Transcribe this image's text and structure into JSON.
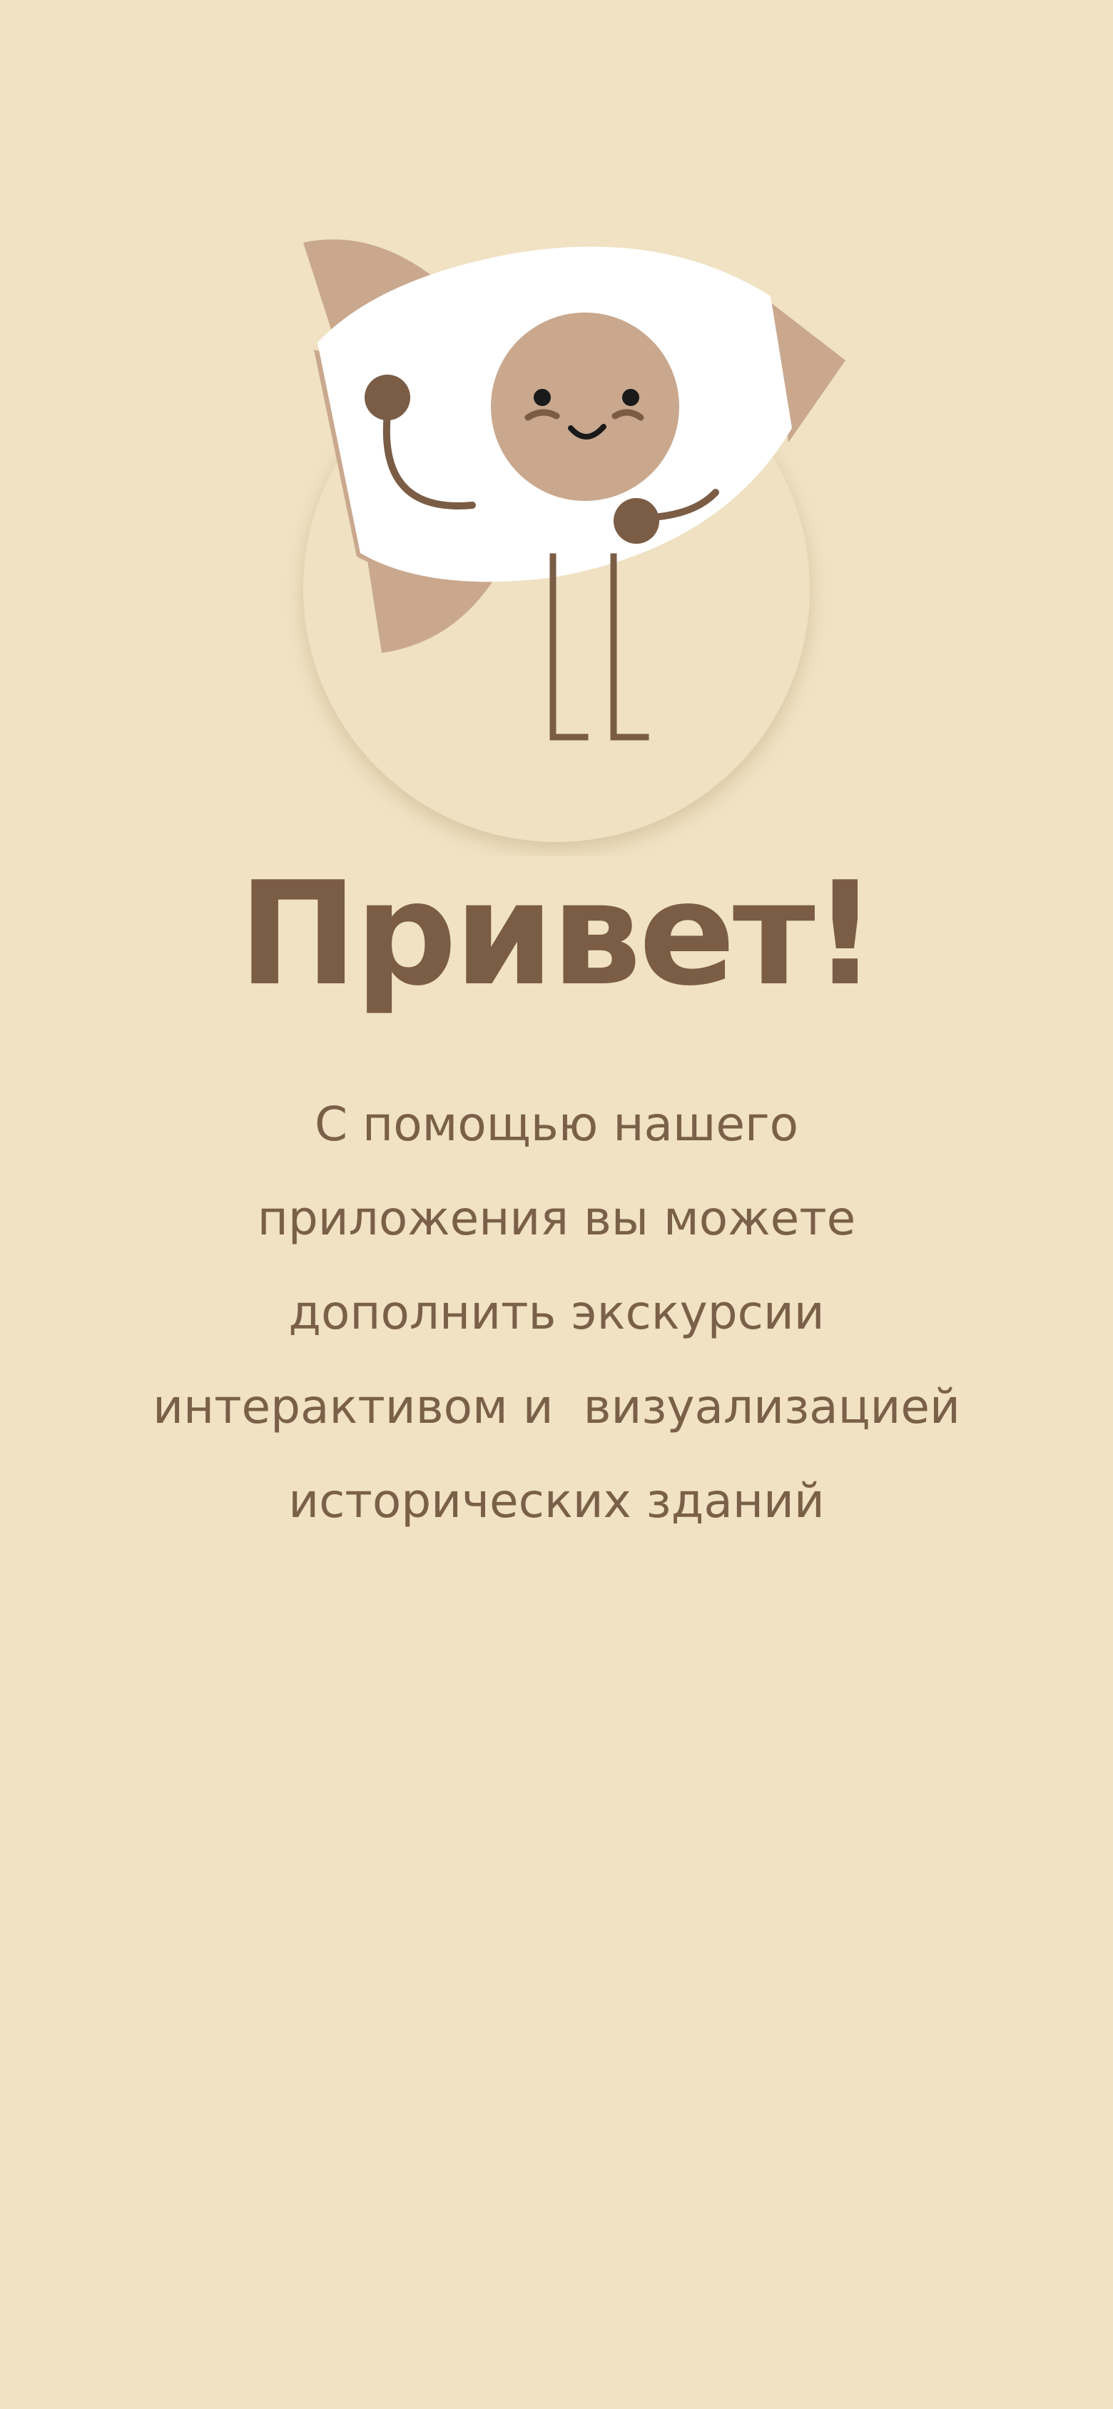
{
  "greeting": {
    "title": "Привет!",
    "lines": [
      "С помощью нашего",
      "приложения вы можете",
      "дополнить экскурсии",
      "интерактивом и  визуализацией",
      "исторических зданий"
    ]
  },
  "colors": {
    "background": "#f0e2c3",
    "accent_dark": "#7b5c45",
    "accent_tan": "#c9a88e",
    "text": "#7a6048",
    "white": "#ffffff"
  },
  "icons": [
    "rocket-mascot-illustration"
  ]
}
